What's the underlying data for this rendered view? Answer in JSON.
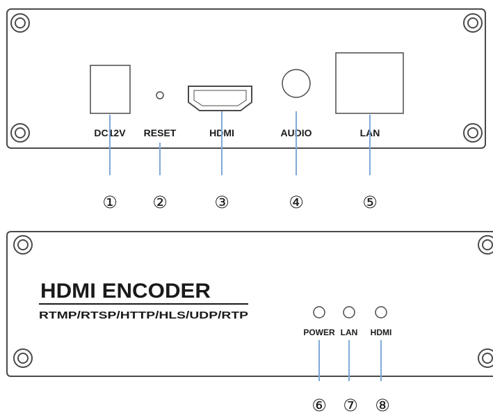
{
  "rear_panel": {
    "ports": [
      {
        "label": "DC12V"
      },
      {
        "label": "RESET"
      },
      {
        "label": "HDMI"
      },
      {
        "label": "AUDIO"
      },
      {
        "label": "LAN"
      }
    ],
    "callouts": [
      "①",
      "②",
      "③",
      "④",
      "⑤"
    ]
  },
  "front_panel": {
    "title": "HDMI ENCODER",
    "subtitle": "RTMP/RTSP/HTTP/HLS/UDP/RTP",
    "leds": [
      {
        "label": "POWER"
      },
      {
        "label": "LAN"
      },
      {
        "label": "HDMI"
      }
    ],
    "callouts": [
      "⑥",
      "⑦",
      "⑧"
    ]
  },
  "colors": {
    "outline": "#4a4a4a",
    "leader_line": "#7fa8d8",
    "text": "#1a1a1a"
  }
}
